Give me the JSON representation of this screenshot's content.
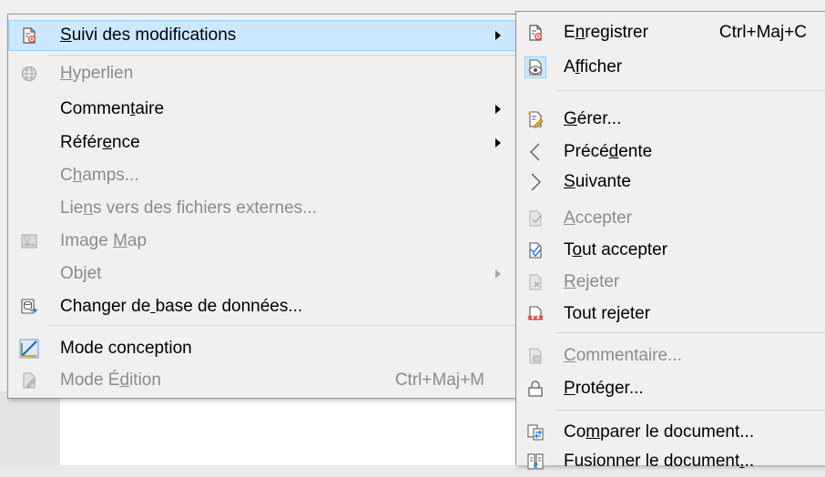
{
  "main_menu": {
    "items": [
      {
        "label": "Suivi des modifications",
        "mnemonic_index": 0,
        "icon": "track-changes-icon",
        "submenu": true,
        "highlighted": true
      },
      {
        "label": "Hyperlien",
        "mnemonic_index": 0,
        "icon": "globe-icon",
        "disabled": true
      },
      {
        "label": "Commentaire",
        "mnemonic_index": 6,
        "submenu": true
      },
      {
        "label": "Référence",
        "mnemonic_index": 5,
        "submenu": true
      },
      {
        "label": "Champs...",
        "mnemonic_index": 1,
        "disabled": true
      },
      {
        "label": "Liens vers des fichiers externes...",
        "mnemonic_index": 3,
        "disabled": true
      },
      {
        "label": "Image Map",
        "mnemonic_index": 6,
        "icon": "image-map-icon",
        "disabled": true
      },
      {
        "label": "Objet",
        "mnemonic_index": 2,
        "submenu": true,
        "disabled": true
      },
      {
        "label": "Changer de base de données...",
        "mnemonic_index": 10,
        "icon": "database-change-icon"
      },
      {
        "label": "Mode conception",
        "mnemonic_index": -1,
        "icon": "design-mode-icon"
      },
      {
        "label": "Mode Édition",
        "mnemonic_index": 6,
        "icon": "edit-mode-icon",
        "disabled": true,
        "shortcut": "Ctrl+Maj+M"
      }
    ]
  },
  "sub_menu": {
    "items": [
      {
        "label": "Enregistrer",
        "mnemonic_index": 1,
        "icon": "record-changes-icon",
        "shortcut": "Ctrl+Maj+C"
      },
      {
        "label": "Afficher",
        "mnemonic_index": 1,
        "icon": "show-changes-icon"
      },
      {
        "label": "Gérer...",
        "mnemonic_index": 0,
        "icon": "manage-changes-icon"
      },
      {
        "label": "Précédente",
        "mnemonic_index": 5,
        "icon": "chevron-left-icon"
      },
      {
        "label": "Suivante",
        "mnemonic_index": 0,
        "icon": "chevron-right-icon"
      },
      {
        "label": "Accepter",
        "mnemonic_index": 0,
        "icon": "accept-change-icon",
        "disabled": true
      },
      {
        "label": "Tout accepter",
        "mnemonic_index": 1,
        "icon": "accept-all-icon"
      },
      {
        "label": "Rejeter",
        "mnemonic_index": 0,
        "icon": "reject-change-icon",
        "disabled": true
      },
      {
        "label": "Tout rejeter",
        "mnemonic_index": 7,
        "icon": "reject-all-icon"
      },
      {
        "label": "Commentaire...",
        "mnemonic_index": 0,
        "icon": "comment-change-icon",
        "disabled": true
      },
      {
        "label": "Protéger...",
        "mnemonic_index": 0,
        "icon": "lock-icon"
      },
      {
        "label": "Comparer le document...",
        "mnemonic_index": 2,
        "icon": "compare-document-icon"
      },
      {
        "label": "Fusionner le document...",
        "mnemonic_index": 21,
        "icon": "merge-document-icon"
      }
    ]
  },
  "colors": {
    "highlight_bg": "#cce8ff",
    "highlight_border": "#99d1ff",
    "menu_bg": "#f0f0f0",
    "disabled_text": "#8b8b8b"
  }
}
